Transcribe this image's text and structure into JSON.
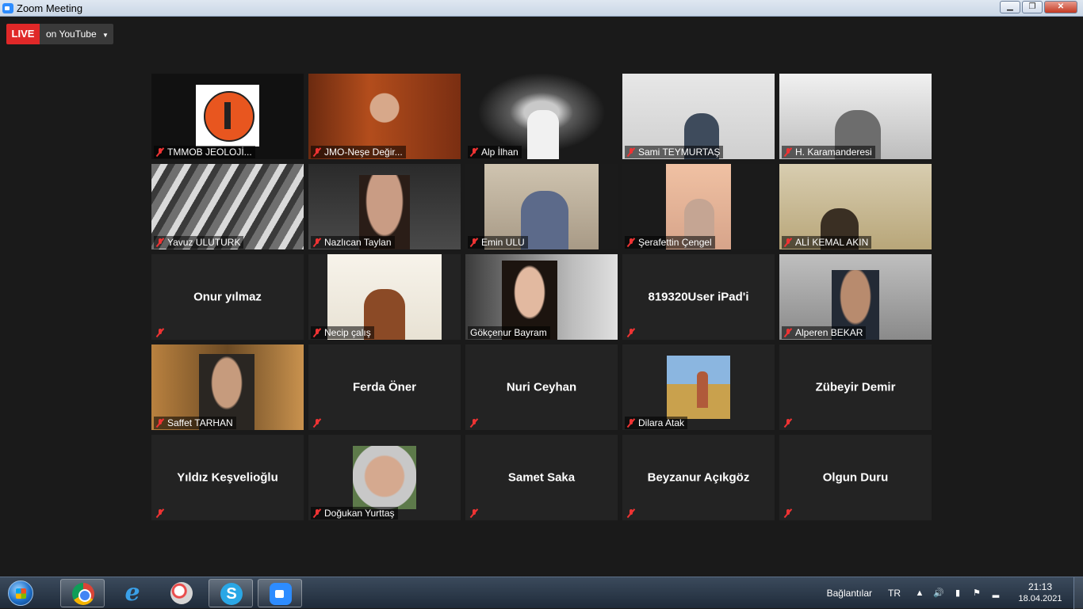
{
  "window": {
    "title": "Zoom Meeting",
    "minimize": "▁",
    "maximize": "❐",
    "close": "✕"
  },
  "live": {
    "badge": "LIVE",
    "destination": "on YouTube",
    "caret": "▼"
  },
  "participants": [
    {
      "name": "TMMOB JEOLOJİ...",
      "video": "logo"
    },
    {
      "name": "JMO-Neşe Değir...",
      "video": "warm"
    },
    {
      "name": "Alp İlhan",
      "video": "tunnel"
    },
    {
      "name": "Sami TEYMURTAŞ",
      "video": "room"
    },
    {
      "name": "H. Karamanderesi",
      "video": "room2"
    },
    {
      "name": "Yavuz ULUTURK",
      "video": "ruin"
    },
    {
      "name": "Nazlıcan Taylan",
      "video": "dark"
    },
    {
      "name": "Emin ULU",
      "video": "shelf"
    },
    {
      "name": "Şerafettin Çengel",
      "video": "pink"
    },
    {
      "name": "ALİ KEMAL AKIN",
      "video": "beige"
    },
    {
      "name": "Onur yılmaz",
      "video": "none"
    },
    {
      "name": "Necip çalış",
      "video": "art"
    },
    {
      "name": "Gökçenur Bayram",
      "video": "girl",
      "active": true
    },
    {
      "name": "819320User iPad'i",
      "video": "none"
    },
    {
      "name": "Alperen BEKAR",
      "video": "grey"
    },
    {
      "name": "Saffet TARHAN",
      "video": "mine"
    },
    {
      "name": "Ferda Öner",
      "video": "none"
    },
    {
      "name": "Nuri Ceyhan",
      "video": "none"
    },
    {
      "name": "Dilara Atak",
      "video": "field"
    },
    {
      "name": "Zübeyir Demir",
      "video": "none"
    },
    {
      "name": "Yıldız Keşvelioğlu",
      "video": "none"
    },
    {
      "name": "Doğukan Yurttaş",
      "video": "man"
    },
    {
      "name": "Samet Saka",
      "video": "none"
    },
    {
      "name": "Beyzanur Açıkgöz",
      "video": "none"
    },
    {
      "name": "Olgun Duru",
      "video": "none"
    }
  ],
  "taskbar": {
    "apps": [
      {
        "name": "chrome-icon",
        "pinned": true
      },
      {
        "name": "internet-explorer-icon",
        "pinned": false
      },
      {
        "name": "paint-icon",
        "pinned": false
      },
      {
        "name": "skype-icon",
        "pinned": true
      },
      {
        "name": "zoom-icon",
        "pinned": true
      }
    ],
    "tray": {
      "links": "Bağlantılar",
      "lang": "TR",
      "time": "21:13",
      "date": "18.04.2021"
    }
  },
  "colors": {
    "live": "#e02828",
    "active_speaker": "#c8e64b",
    "muted": "#ee3333"
  }
}
